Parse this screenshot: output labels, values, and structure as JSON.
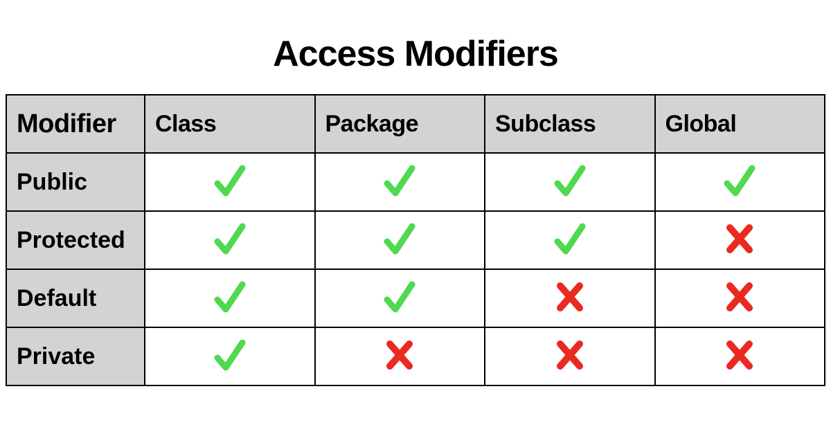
{
  "title": "Access Modifiers",
  "columns": [
    "Modifier",
    "Class",
    "Package",
    "Subclass",
    "Global"
  ],
  "rows": [
    {
      "label": "Public",
      "values": [
        "check",
        "check",
        "check",
        "check"
      ]
    },
    {
      "label": "Protected",
      "values": [
        "check",
        "check",
        "check",
        "cross"
      ]
    },
    {
      "label": "Default",
      "values": [
        "check",
        "check",
        "cross",
        "cross"
      ]
    },
    {
      "label": "Private",
      "values": [
        "check",
        "cross",
        "cross",
        "cross"
      ]
    }
  ],
  "colors": {
    "check": "#4fd94f",
    "cross": "#ea2a1f"
  }
}
